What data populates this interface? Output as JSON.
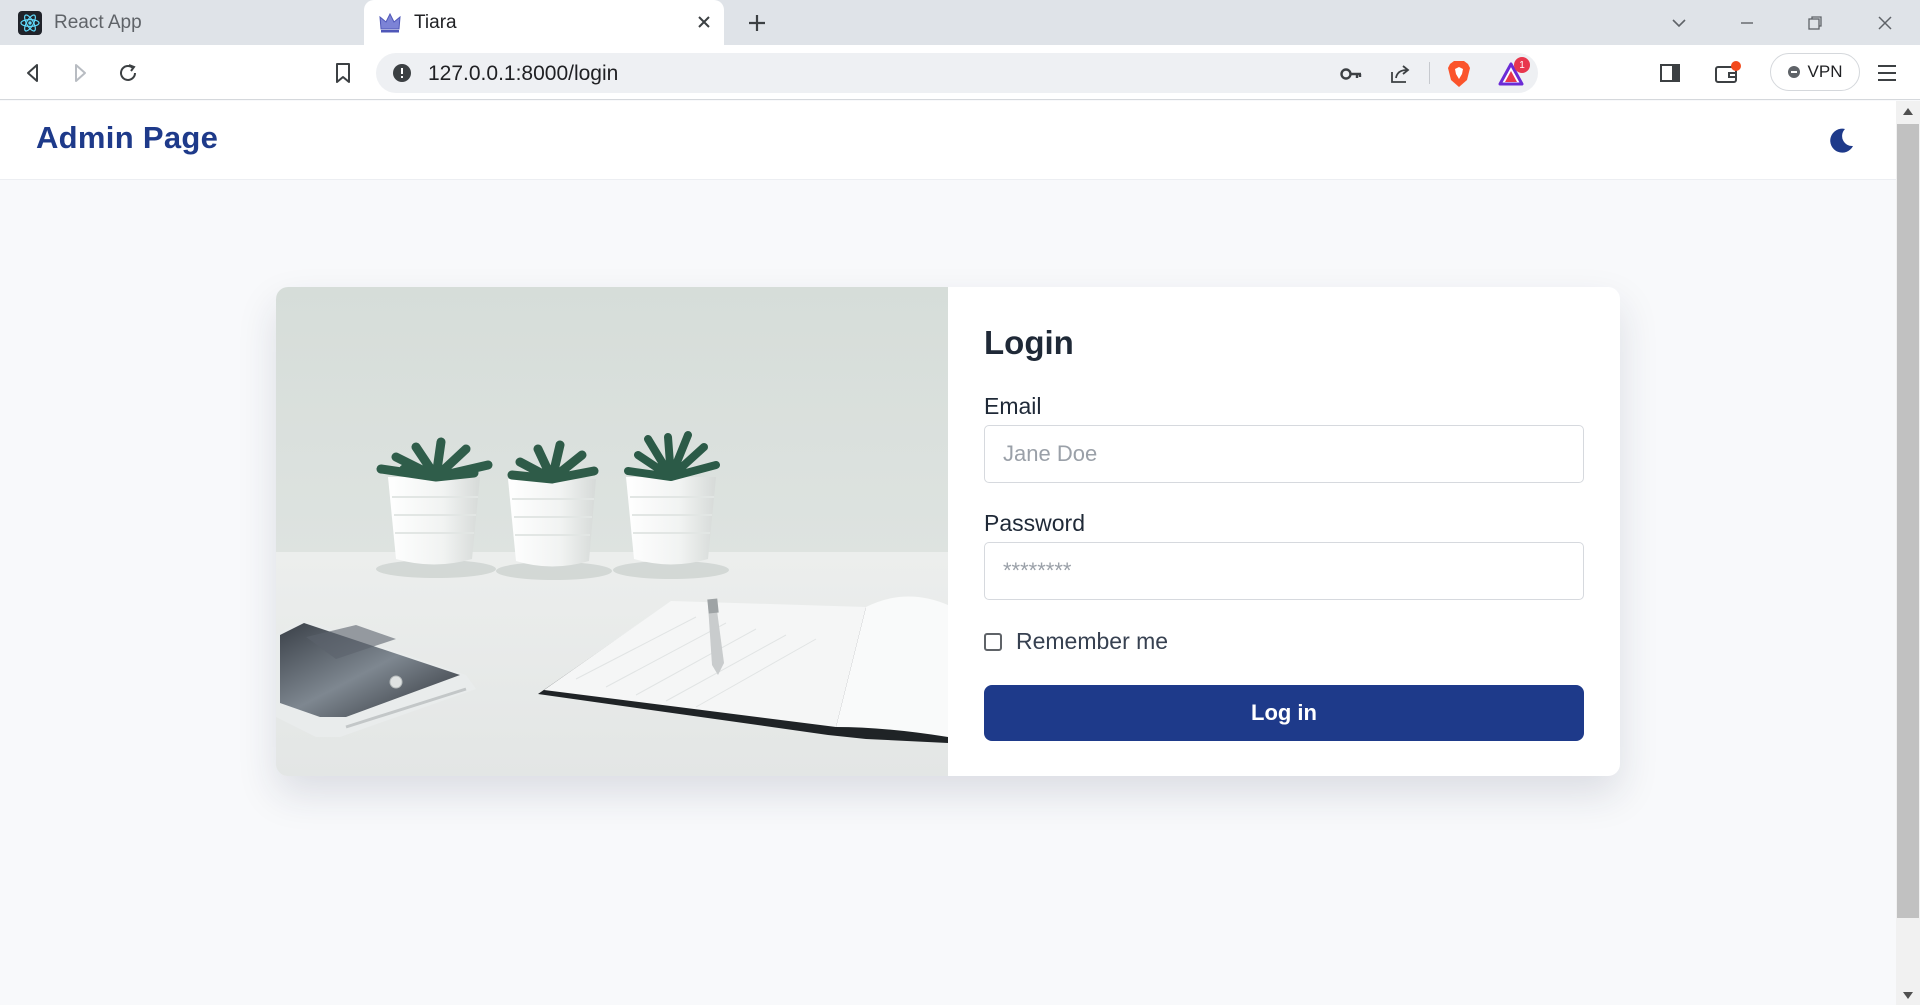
{
  "browser": {
    "tabs": [
      {
        "label": "React App",
        "active": false
      },
      {
        "label": "Tiara",
        "active": true
      }
    ],
    "address": {
      "url": "127.0.0.1:8000/login"
    },
    "notification_badge": "1",
    "vpn_label": "VPN"
  },
  "header": {
    "brand": "Admin Page",
    "theme_toggle_icon": "moon-icon"
  },
  "login_form": {
    "title": "Login",
    "email_label": "Email",
    "email_placeholder": "Jane Doe",
    "password_label": "Password",
    "password_placeholder": "********",
    "remember_label": "Remember me",
    "remember_checked": false,
    "submit_label": "Log in"
  },
  "colors": {
    "accent": "#1e3a8a",
    "page_background": "#f8f9fb",
    "card_background": "#ffffff"
  }
}
